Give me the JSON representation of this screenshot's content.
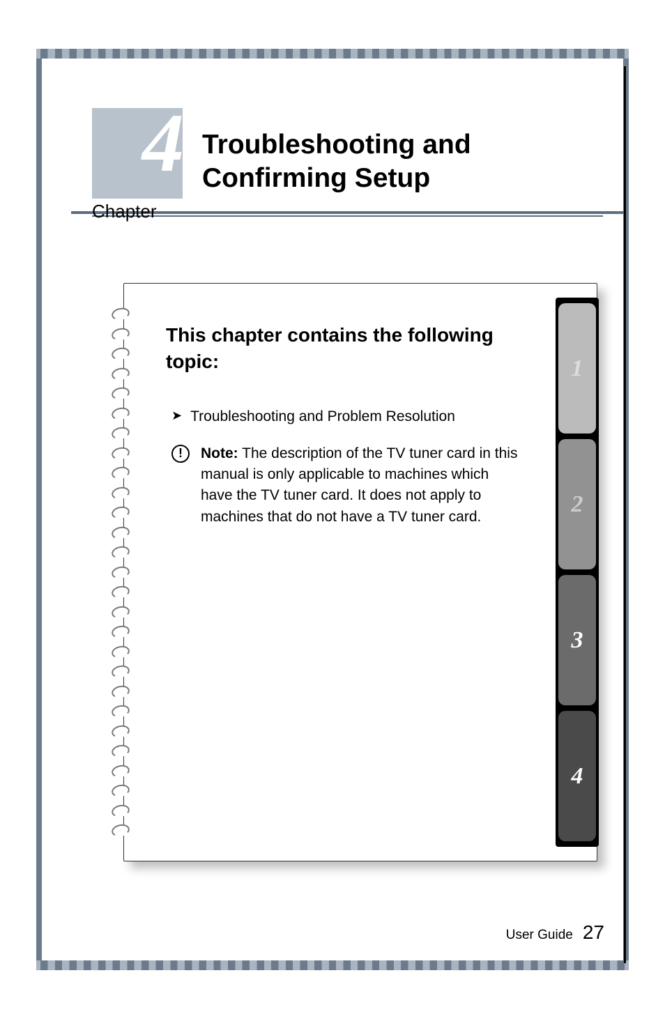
{
  "chapter": {
    "number": "4",
    "label": "Chapter",
    "title": "Troubleshooting and Confirming Setup"
  },
  "card": {
    "heading": "This chapter contains the following topic:",
    "topics": [
      "Troubleshooting and Problem Resolution"
    ],
    "note_label": "Note:",
    "note_body": "The description of the TV tuner card in this manual is only applicable to machines which have the TV tuner card. It does not apply to machines that do not have a TV tuner card."
  },
  "tabs": [
    "1",
    "2",
    "3",
    "4"
  ],
  "footer": {
    "label": "User Guide",
    "page": "27"
  }
}
